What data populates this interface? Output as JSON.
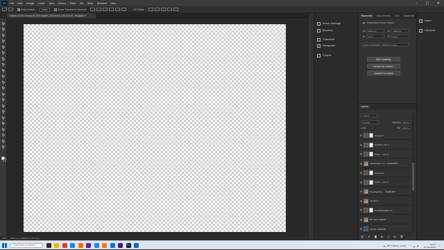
{
  "app": {
    "logo": "Ps"
  },
  "menu": [
    "File",
    "Edit",
    "Image",
    "Layer",
    "Type",
    "Select",
    "Filter",
    "3D",
    "View",
    "Window",
    "Help"
  ],
  "window_controls": [
    "minimize-icon",
    "maximize-icon",
    "close-icon"
  ],
  "options_bar": {
    "auto_select_label": "Auto-Select:",
    "auto_select_value": "Layer",
    "show_transform_label": "Show Transform Controls",
    "mode_3d_label": "3D Mode:"
  },
  "document_tab": {
    "title": "octane-1578119.psd @ 25% (DAVE_20220422_055219-01, RGB/8#) *"
  },
  "status_bar": {
    "zoom": "25%",
    "doc_info": "4800 px x 3600 px (300 ppi)"
  },
  "collapsed_panels": [
    {
      "label": "Brush Settings",
      "icon": "brush-icon"
    },
    {
      "label": "Brushes",
      "icon": "brushes-icon"
    },
    {
      "label": "Character",
      "icon": "character-icon"
    },
    {
      "label": "Paragraph",
      "icon": "paragraph-icon"
    },
    {
      "label": "Glyphs",
      "icon": "glyphs-icon"
    }
  ],
  "properties": {
    "tabs": [
      "Properties",
      "Adjustments",
      "Info",
      "Swatches",
      "Styles"
    ],
    "object_type": "Embedded Smart Object",
    "w_label": "W:",
    "w_value": "4800 px",
    "h_label": "H:",
    "h_value": "3600 px",
    "x_label": "X:",
    "x_value": "0 px",
    "y_label": "Y:",
    "y_value": "0 px",
    "filename": "DAVE_20220422_055219-01.jpg",
    "buttons": [
      "Edit Contents",
      "Convert to Linked...",
      "Convert to Layers"
    ]
  },
  "layers_panel": {
    "title": "Layers",
    "kind_label": "Kind",
    "blend_mode": "Normal",
    "opacity_label": "Opacity:",
    "opacity_value": "100%",
    "lock_label": "Lock:",
    "fill_label": "Fill:",
    "fill_value": "100%",
    "layers": [
      {
        "name": "Curves 7",
        "type": "adjustment"
      },
      {
        "name": "Hue/Sa...ion 1",
        "type": "adjustment"
      },
      {
        "name": "Color ...nce 3",
        "type": "adjustment"
      },
      {
        "name": "Landscape, lu..., DARK-NTT",
        "type": "image"
      },
      {
        "name": "Curves 6",
        "type": "adjustment"
      },
      {
        "name": "Color ...nce 2",
        "type": "adjustment"
      },
      {
        "name": "Overlays by ... DARK-NTT",
        "type": "image"
      },
      {
        "name": "candle 1",
        "type": "image"
      },
      {
        "name": "Hue/Saturation 2",
        "type": "adjustment"
      },
      {
        "name": "Fill mem 20004",
        "type": "image"
      },
      {
        "name": "Smart 1041006",
        "type": "smart"
      }
    ]
  },
  "right_panel": [
    "Learn",
    "Libraries"
  ],
  "taskbar": {
    "search_placeholder": "Type here to search",
    "apps": [
      {
        "label": "",
        "color": "#2b2b2b",
        "icon": "task-view-icon"
      },
      {
        "label": "",
        "color": "#f4b400",
        "icon": "file-explorer-icon"
      },
      {
        "label": "",
        "color": "#e53935",
        "icon": "chrome-icon"
      },
      {
        "label": "",
        "color": "#0a84ff",
        "icon": "edge-icon"
      },
      {
        "label": "",
        "color": "#ff6d00",
        "icon": "app-icon"
      },
      {
        "label": "",
        "color": "#6a1b9a",
        "icon": "app-icon"
      },
      {
        "label": "",
        "color": "#1e88e5",
        "icon": "app-icon"
      },
      {
        "label": "",
        "color": "#f57c00",
        "icon": "app-icon"
      },
      {
        "label": "",
        "color": "#0078d4",
        "icon": "mail-icon"
      },
      {
        "label": "",
        "color": "#4a148c",
        "icon": "app-icon"
      },
      {
        "label": "Ps",
        "color": "#001e36",
        "icon": "photoshop-icon"
      },
      {
        "label": "",
        "color": "#1565c0",
        "icon": "app-icon"
      }
    ],
    "weather": "28°C  Partly cloudy",
    "time": "10:51",
    "date": "22-04-2022"
  }
}
